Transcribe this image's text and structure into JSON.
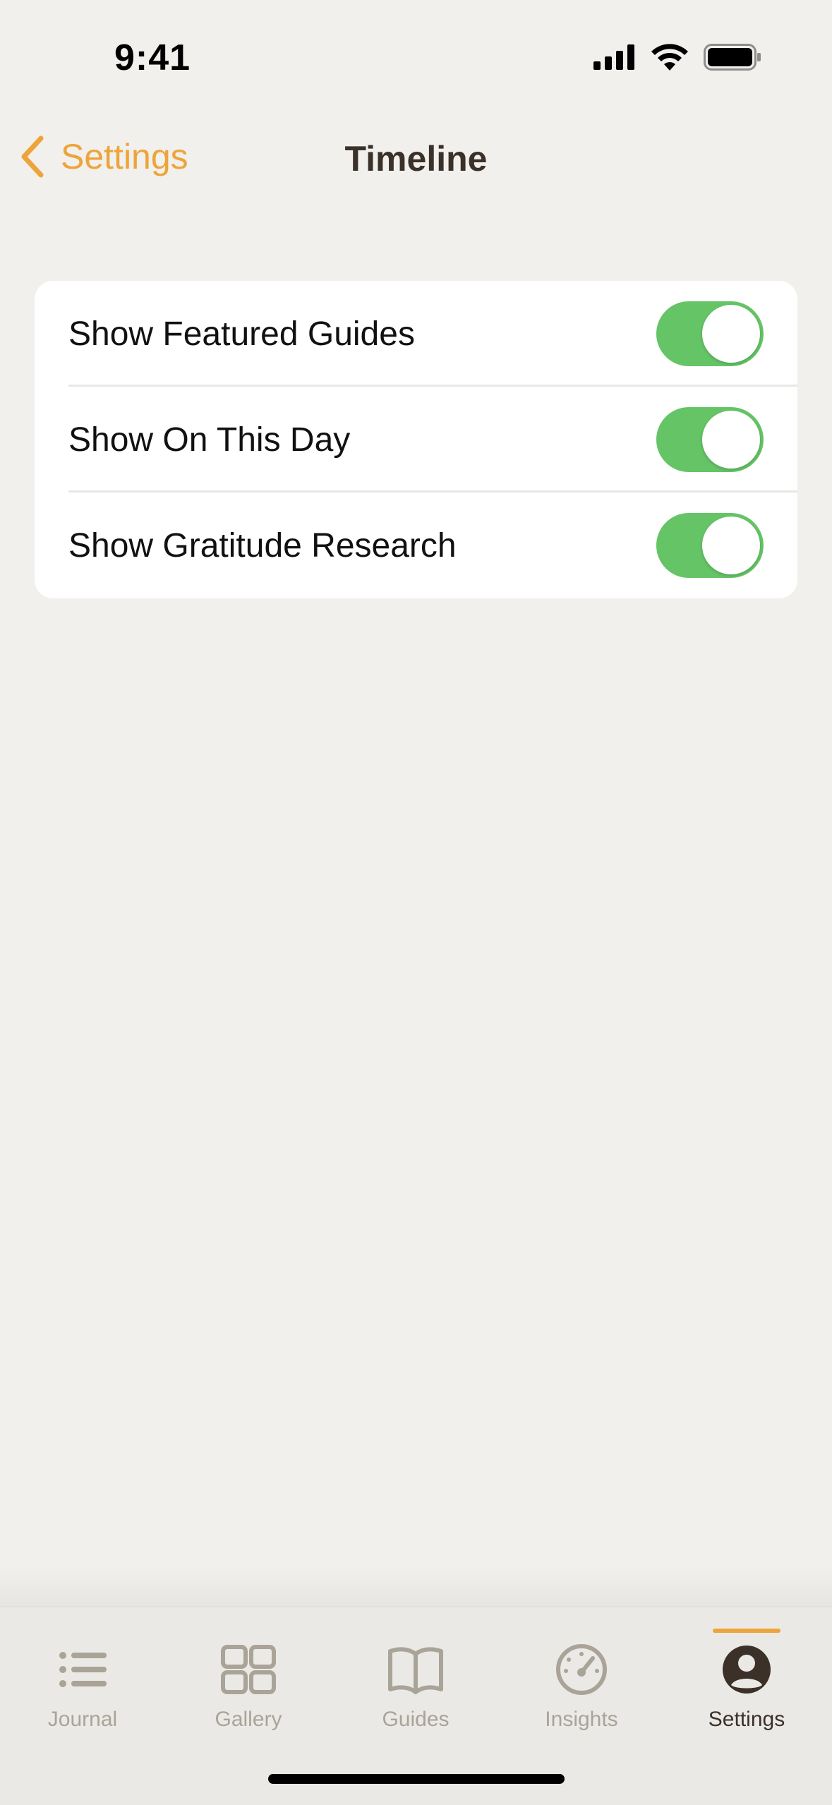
{
  "status_bar": {
    "time": "9:41",
    "icons": [
      "cellular-signal-icon",
      "wifi-icon",
      "battery-icon"
    ]
  },
  "nav": {
    "back_label": "Settings",
    "title": "Timeline"
  },
  "settings": [
    {
      "label": "Show Featured Guides",
      "enabled": true
    },
    {
      "label": "Show On This Day",
      "enabled": true
    },
    {
      "label": "Show Gratitude Research",
      "enabled": true
    }
  ],
  "tabbar": {
    "tabs": [
      {
        "label": "Journal",
        "icon": "list-icon",
        "active": false
      },
      {
        "label": "Gallery",
        "icon": "grid-icon",
        "active": false
      },
      {
        "label": "Guides",
        "icon": "book-icon",
        "active": false
      },
      {
        "label": "Insights",
        "icon": "gauge-icon",
        "active": false
      },
      {
        "label": "Settings",
        "icon": "person-icon",
        "active": true
      }
    ]
  },
  "colors": {
    "accent": "#eda43a",
    "toggle_on": "#65c466",
    "background": "#f1f0ed",
    "title": "#3b3129",
    "tab_inactive": "#aaa398"
  }
}
